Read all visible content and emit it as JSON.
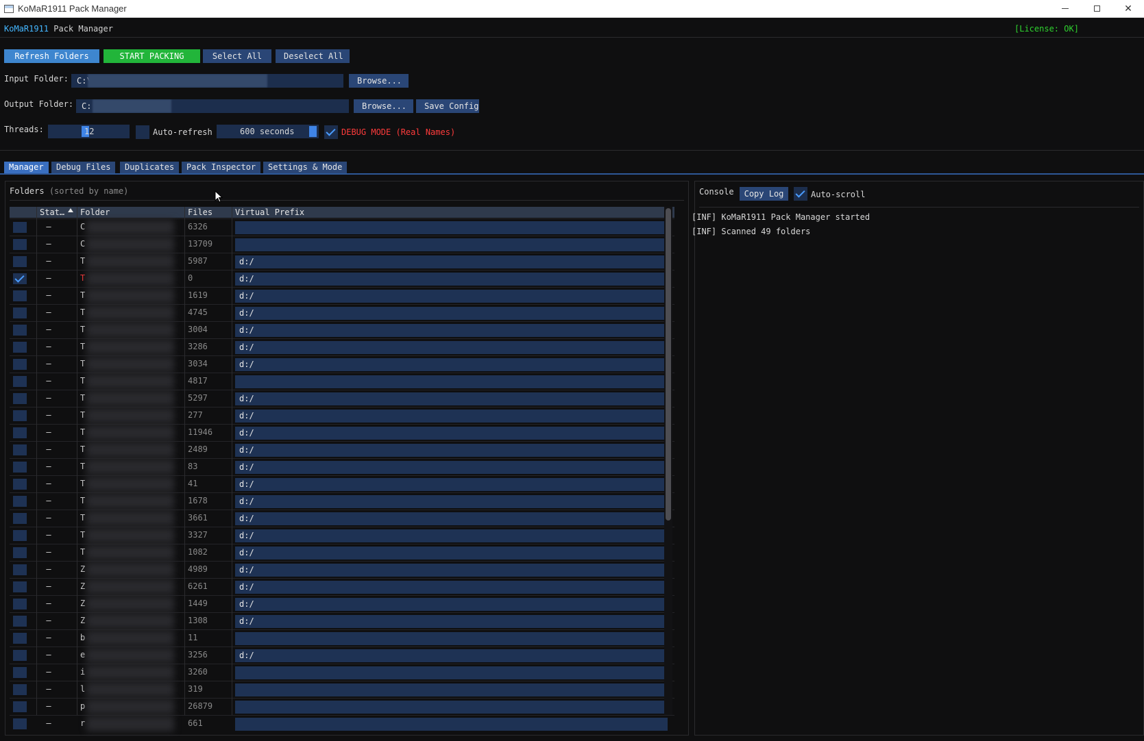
{
  "window": {
    "title": "KoMaR1911 Pack Manager",
    "minimize_glyph": "",
    "maximize_glyph": "",
    "close_glyph": "✕"
  },
  "header": {
    "brand": "KoMaR1911",
    "brand_suffix": " Pack Manager",
    "license": "[License: OK]"
  },
  "toolbar": {
    "refresh": "Refresh Folders",
    "start": "START PACKING",
    "select_all": "Select All",
    "deselect_all": "Deselect All"
  },
  "config": {
    "input_label": "Input Folder:",
    "input_value": "C:\\",
    "input_browse": "Browse...",
    "output_label": "Output Folder:",
    "output_value": "C:",
    "output_browse": "Browse...",
    "save_config": "Save Config",
    "threads_label": "Threads:",
    "threads_value": "12",
    "threads_fraction": 0.45,
    "auto_refresh_label": "Auto-refresh",
    "auto_refresh_checked": false,
    "refresh_interval": "600 seconds",
    "debug_label": "DEBUG MODE (Real Names)",
    "debug_checked": true
  },
  "tabs": [
    {
      "label": "Manager",
      "active": true
    },
    {
      "label": "Debug Files",
      "active": false
    },
    {
      "label": "Duplicates",
      "active": false
    },
    {
      "label": "Pack Inspector",
      "active": false
    },
    {
      "label": "Settings & Mode",
      "active": false
    }
  ],
  "folders_panel": {
    "title": "Folders",
    "subtitle": "(sorted by name)",
    "columns": [
      "Stat…",
      "Folder",
      "Files",
      "Virtual Prefix"
    ],
    "rows": [
      {
        "checked": false,
        "status": "–",
        "initial": "C",
        "files": "6326",
        "prefix": "",
        "missing": false
      },
      {
        "checked": false,
        "status": "–",
        "initial": "C",
        "files": "13709",
        "prefix": "",
        "missing": false
      },
      {
        "checked": false,
        "status": "–",
        "initial": "T",
        "files": "5987",
        "prefix": "d:/",
        "missing": false
      },
      {
        "checked": true,
        "status": "–",
        "initial": "T",
        "files": "0",
        "prefix": "d:/",
        "missing": true
      },
      {
        "checked": false,
        "status": "–",
        "initial": "T",
        "files": "1619",
        "prefix": "d:/",
        "missing": false
      },
      {
        "checked": false,
        "status": "–",
        "initial": "T",
        "files": "4745",
        "prefix": "d:/",
        "missing": false
      },
      {
        "checked": false,
        "status": "–",
        "initial": "T",
        "files": "3004",
        "prefix": "d:/",
        "missing": false
      },
      {
        "checked": false,
        "status": "–",
        "initial": "T",
        "files": "3286",
        "prefix": "d:/",
        "missing": false
      },
      {
        "checked": false,
        "status": "–",
        "initial": "T",
        "files": "3034",
        "prefix": "d:/",
        "missing": false
      },
      {
        "checked": false,
        "status": "–",
        "initial": "T",
        "files": "4817",
        "prefix": "",
        "missing": false
      },
      {
        "checked": false,
        "status": "–",
        "initial": "T",
        "files": "5297",
        "prefix": "d:/",
        "missing": false
      },
      {
        "checked": false,
        "status": "–",
        "initial": "T",
        "files": "277",
        "prefix": "d:/",
        "missing": false
      },
      {
        "checked": false,
        "status": "–",
        "initial": "T",
        "files": "11946",
        "prefix": "d:/",
        "missing": false
      },
      {
        "checked": false,
        "status": "–",
        "initial": "T",
        "files": "2489",
        "prefix": "d:/",
        "missing": false
      },
      {
        "checked": false,
        "status": "–",
        "initial": "T",
        "files": "83",
        "prefix": "d:/",
        "missing": false
      },
      {
        "checked": false,
        "status": "–",
        "initial": "T",
        "files": "41",
        "prefix": "d:/",
        "missing": false
      },
      {
        "checked": false,
        "status": "–",
        "initial": "T",
        "files": "1678",
        "prefix": "d:/",
        "missing": false
      },
      {
        "checked": false,
        "status": "–",
        "initial": "T",
        "files": "3661",
        "prefix": "d:/",
        "missing": false
      },
      {
        "checked": false,
        "status": "–",
        "initial": "T",
        "files": "3327",
        "prefix": "d:/",
        "missing": false
      },
      {
        "checked": false,
        "status": "–",
        "initial": "T",
        "files": "1082",
        "prefix": "d:/",
        "missing": false
      },
      {
        "checked": false,
        "status": "–",
        "initial": "Z",
        "files": "4989",
        "prefix": "d:/",
        "missing": false
      },
      {
        "checked": false,
        "status": "–",
        "initial": "Z",
        "files": "6261",
        "prefix": "d:/",
        "missing": false
      },
      {
        "checked": false,
        "status": "–",
        "initial": "Z",
        "files": "1449",
        "prefix": "d:/",
        "missing": false
      },
      {
        "checked": false,
        "status": "–",
        "initial": "Z",
        "files": "1308",
        "prefix": "d:/",
        "missing": false
      },
      {
        "checked": false,
        "status": "–",
        "initial": "b",
        "files": "11",
        "prefix": "",
        "missing": false
      },
      {
        "checked": false,
        "status": "–",
        "initial": "e",
        "files": "3256",
        "prefix": "d:/",
        "missing": false
      },
      {
        "checked": false,
        "status": "–",
        "initial": "i",
        "files": "3260",
        "prefix": "",
        "missing": false
      },
      {
        "checked": false,
        "status": "–",
        "initial": "l",
        "files": "319",
        "prefix": "",
        "missing": false
      },
      {
        "checked": false,
        "status": "–",
        "initial": "p",
        "files": "26879",
        "prefix": "",
        "missing": false
      },
      {
        "checked": false,
        "status": "–",
        "initial": "r",
        "files": "661",
        "prefix": "",
        "missing": false
      }
    ]
  },
  "console_panel": {
    "title": "Console",
    "copy_log": "Copy Log",
    "auto_scroll_label": "Auto-scroll",
    "auto_scroll_checked": true,
    "lines": [
      "[INF] KoMaR1911 Pack Manager started",
      "[INF] Scanned 49 folders"
    ]
  },
  "colors": {
    "background": "#0f0f10",
    "button": "#2a4676",
    "accent_blue": "#3e86cf",
    "start_green": "#22b53a",
    "license_green": "#2fd32f",
    "error_red": "#ff3b3b"
  }
}
